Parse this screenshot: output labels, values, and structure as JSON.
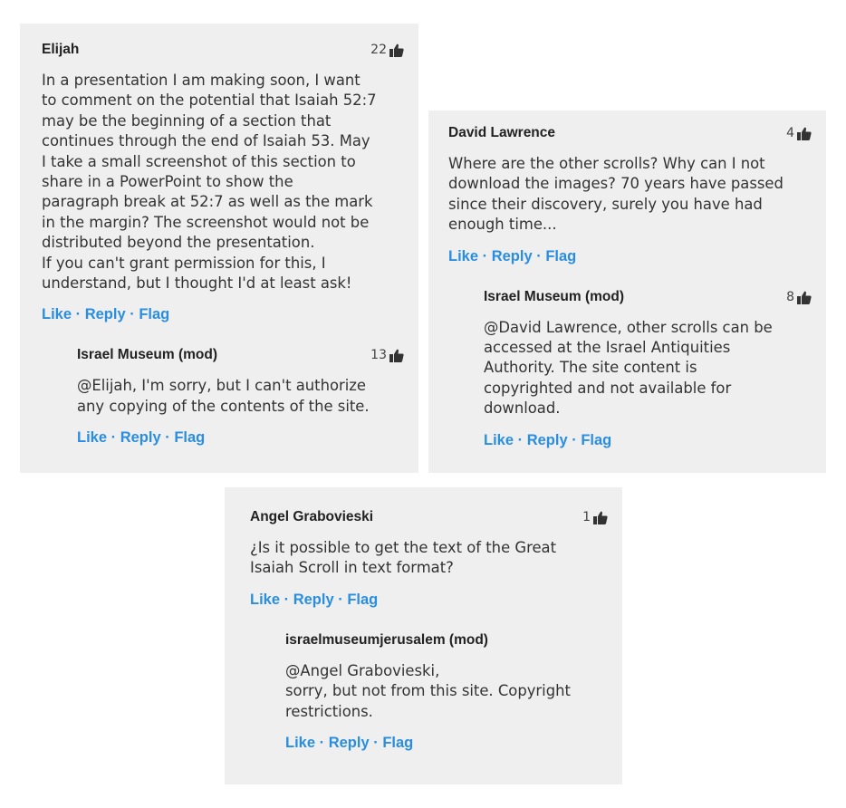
{
  "colors": {
    "card_bg": "#efefef",
    "link": "#2a8ee0",
    "text": "#333333"
  },
  "threads": [
    {
      "comment": {
        "author": "Elijah",
        "likes": "22",
        "body": "In a presentation I am making soon, I want\nto comment on the potential that Isaiah 52:7\nmay be the beginning of a section that\ncontinues through the end of Isaiah 53. May\nI take a small screenshot of this section to\nshare in a PowerPoint to show the\nparagraph break at 52:7 as well as the mark\nin the margin? The screenshot would not be\ndistributed beyond the presentation.\nIf you can't grant permission for this, I\nunderstand, but I thought I'd at least ask!",
        "actions": {
          "like": "Like",
          "reply": "Reply",
          "flag": "Flag",
          "sep": " · "
        }
      },
      "reply": {
        "author": "Israel Museum (mod)",
        "likes": "13",
        "body": "@Elijah, I'm sorry, but I can't authorize\nany copying of the contents of the site.",
        "actions": {
          "like": "Like",
          "reply": "Reply",
          "flag": "Flag",
          "sep": " · "
        }
      }
    },
    {
      "comment": {
        "author": "David Lawrence",
        "likes": "4",
        "body": "Where are the other scrolls? Why can I not\ndownload the images? 70 years have passed\nsince their discovery, surely you have had\nenough time...",
        "actions": {
          "like": "Like",
          "reply": "Reply",
          "flag": "Flag",
          "sep": " · "
        }
      },
      "reply": {
        "author": "Israel Museum (mod)",
        "likes": "8",
        "body": "@David Lawrence, other scrolls can be\naccessed at the Israel Antiquities\nAuthority. The site content is\ncopyrighted and not available for\ndownload.",
        "actions": {
          "like": "Like",
          "reply": "Reply",
          "flag": "Flag",
          "sep": " · "
        }
      }
    },
    {
      "comment": {
        "author": "Angel Grabovieski",
        "likes": "1",
        "body": "¿Is it possible to get the text of the Great\nIsaiah Scroll in text format?",
        "actions": {
          "like": "Like",
          "reply": "Reply",
          "flag": "Flag",
          "sep": " · "
        }
      },
      "reply": {
        "author": "israelmuseumjerusalem (mod)",
        "likes": "",
        "body": "@Angel Grabovieski,\nsorry, but not from this site. Copyright\nrestrictions.",
        "actions": {
          "like": "Like",
          "reply": "Reply",
          "flag": "Flag",
          "sep": " · "
        }
      }
    }
  ]
}
